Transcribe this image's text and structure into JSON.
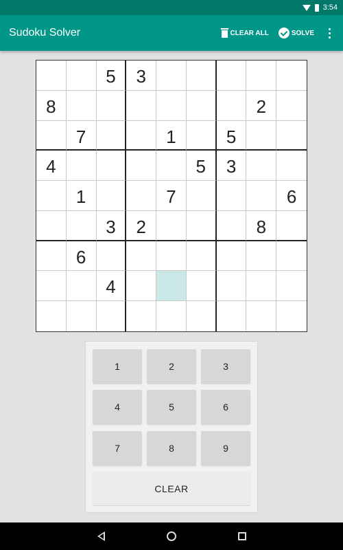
{
  "status_bar": {
    "time": "3:54",
    "icons": [
      "wifi-icon",
      "battery-icon"
    ]
  },
  "app_bar": {
    "title": "Sudoku Solver",
    "actions": [
      {
        "label": "CLEAR ALL",
        "icon": "trash-icon"
      },
      {
        "label": "SOLVE",
        "icon": "check-circle-icon"
      }
    ],
    "overflow_icon": "more-vert-icon"
  },
  "colors": {
    "status_bar": "#00796b",
    "app_bar": "#009688",
    "selected_cell": "#cbe8e8",
    "keypad_bg": "#f1f1f1",
    "key_bg": "#d7d7d7"
  },
  "board": {
    "rows": [
      [
        "",
        "",
        "5",
        "3",
        "",
        "",
        "",
        "",
        ""
      ],
      [
        "8",
        "",
        "",
        "",
        "",
        "",
        "",
        "2",
        ""
      ],
      [
        "",
        "7",
        "",
        "",
        "1",
        "",
        "5",
        "",
        ""
      ],
      [
        "4",
        "",
        "",
        "",
        "",
        "5",
        "3",
        "",
        ""
      ],
      [
        "",
        "1",
        "",
        "",
        "7",
        "",
        "",
        "",
        "6"
      ],
      [
        "",
        "",
        "3",
        "2",
        "",
        "",
        "",
        "8",
        ""
      ],
      [
        "",
        "6",
        "",
        "",
        "",
        "",
        "",
        "",
        ""
      ],
      [
        "",
        "",
        "4",
        "",
        "",
        "",
        "",
        "",
        ""
      ],
      [
        "",
        "",
        "",
        "",
        "",
        "",
        "",
        "",
        ""
      ]
    ],
    "selected": {
      "row": 7,
      "col": 4
    }
  },
  "keypad": {
    "keys": [
      "1",
      "2",
      "3",
      "4",
      "5",
      "6",
      "7",
      "8",
      "9"
    ],
    "clear_label": "CLEAR"
  },
  "nav_bar": {
    "icons": [
      "back-icon",
      "home-icon",
      "recents-icon"
    ]
  }
}
